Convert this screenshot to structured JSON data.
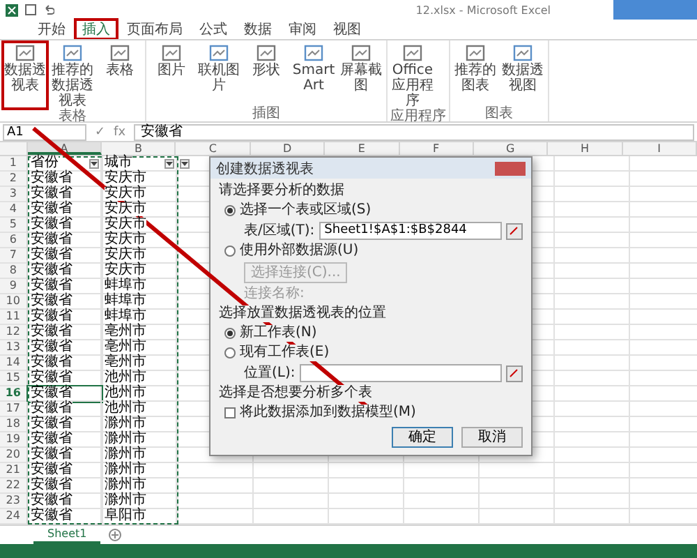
{
  "window": {
    "title": "12.xlsx - Microsoft Excel"
  },
  "tabs": [
    {
      "label": "开始",
      "selected": false,
      "highlighted": false
    },
    {
      "label": "插入",
      "selected": true,
      "highlighted": true
    },
    {
      "label": "页面布局",
      "selected": false,
      "highlighted": false
    },
    {
      "label": "公式",
      "selected": false,
      "highlighted": false
    },
    {
      "label": "数据",
      "selected": false,
      "highlighted": false
    },
    {
      "label": "审阅",
      "selected": false,
      "highlighted": false
    },
    {
      "label": "视图",
      "selected": false,
      "highlighted": false
    }
  ],
  "ribbon": {
    "groups": [
      {
        "label": "表格",
        "buttons": [
          {
            "label": "数据透视表",
            "highlighted": true
          },
          {
            "label": "推荐的数据透视表",
            "highlighted": false
          },
          {
            "label": "表格",
            "highlighted": false
          }
        ]
      },
      {
        "label": "插图",
        "buttons": [
          {
            "label": "图片",
            "highlighted": false
          },
          {
            "label": "联机图片",
            "highlighted": false
          },
          {
            "label": "形状",
            "highlighted": false
          },
          {
            "label": "SmartArt",
            "highlighted": false
          },
          {
            "label": "屏幕截图",
            "highlighted": false
          }
        ]
      },
      {
        "label": "应用程序",
        "buttons": [
          {
            "label": "Office应用程序",
            "highlighted": false
          }
        ]
      },
      {
        "label": "图表",
        "buttons": [
          {
            "label": "推荐的图表",
            "highlighted": false
          },
          {
            "label": "数据透视图",
            "highlighted": false
          }
        ]
      }
    ]
  },
  "formula_bar": {
    "name_box": "A1",
    "confirm": "✓",
    "function": "fx",
    "value": "安徽省"
  },
  "sheet": {
    "columns": [
      "A",
      "B",
      "C",
      "D",
      "E",
      "F",
      "G",
      "H",
      "I"
    ],
    "rows": [
      {
        "number": "1",
        "cells": [
          "省份",
          "城市"
        ],
        "selected": false
      },
      {
        "number": "2",
        "cells": [
          "安徽省",
          "安庆市"
        ],
        "selected": false
      },
      {
        "number": "3",
        "cells": [
          "安徽省",
          "安庆市"
        ],
        "selected": false
      },
      {
        "number": "4",
        "cells": [
          "安徽省",
          "安庆市"
        ],
        "selected": false
      },
      {
        "number": "5",
        "cells": [
          "安徽省",
          "安庆市"
        ],
        "selected": false
      },
      {
        "number": "6",
        "cells": [
          "安徽省",
          "安庆市"
        ],
        "selected": false
      },
      {
        "number": "7",
        "cells": [
          "安徽省",
          "安庆市"
        ],
        "selected": false
      },
      {
        "number": "8",
        "cells": [
          "安徽省",
          "安庆市"
        ],
        "selected": false
      },
      {
        "number": "9",
        "cells": [
          "安徽省",
          "蚌埠市"
        ],
        "selected": false
      },
      {
        "number": "10",
        "cells": [
          "安徽省",
          "蚌埠市"
        ],
        "selected": false
      },
      {
        "number": "11",
        "cells": [
          "安徽省",
          "蚌埠市"
        ],
        "selected": false
      },
      {
        "number": "12",
        "cells": [
          "安徽省",
          "亳州市"
        ],
        "selected": false
      },
      {
        "number": "13",
        "cells": [
          "安徽省",
          "亳州市"
        ],
        "selected": false
      },
      {
        "number": "14",
        "cells": [
          "安徽省",
          "亳州市"
        ],
        "selected": false
      },
      {
        "number": "15",
        "cells": [
          "安徽省",
          "池州市"
        ],
        "selected": false
      },
      {
        "number": "16",
        "cells": [
          "安徽省",
          "池州市"
        ],
        "selected": true
      },
      {
        "number": "17",
        "cells": [
          "安徽省",
          "池州市"
        ],
        "selected": false
      },
      {
        "number": "18",
        "cells": [
          "安徽省",
          "滁州市"
        ],
        "selected": false
      },
      {
        "number": "19",
        "cells": [
          "安徽省",
          "滁州市"
        ],
        "selected": false
      },
      {
        "number": "20",
        "cells": [
          "安徽省",
          "滁州市"
        ],
        "selected": false
      },
      {
        "number": "21",
        "cells": [
          "安徽省",
          "滁州市"
        ],
        "selected": false
      },
      {
        "number": "22",
        "cells": [
          "安徽省",
          "滁州市"
        ],
        "selected": false
      },
      {
        "number": "23",
        "cells": [
          "安徽省",
          "滁州市"
        ],
        "selected": false
      },
      {
        "number": "24",
        "cells": [
          "安徽省",
          "阜阳市"
        ],
        "selected": false
      }
    ],
    "sheet_tabs": [
      {
        "label": "Sheet1",
        "selected": true
      }
    ]
  },
  "dialog": {
    "title": "创建数据透视表",
    "section_1": "请选择要分析的数据",
    "options_1": [
      {
        "label": "选择一个表或区域(S)",
        "selected": true
      },
      {
        "label": "使用外部数据源(U)",
        "selected": false
      }
    ],
    "range_label": "表/区域(T):",
    "range_value": "Sheet1!$A$1:$B$2844",
    "connection_button": "选择连接(C)...",
    "connection_name": "连接名称:",
    "section_2": "选择放置数据透视表的位置",
    "options_2": [
      {
        "label": "新工作表(N)",
        "selected": true
      },
      {
        "label": "现有工作表(E)",
        "selected": false
      }
    ],
    "location_label": "位置(L):",
    "section_3": "选择是否想要分析多个表",
    "data_model": {
      "label": "将此数据添加到数据模型(M)",
      "checked": false
    },
    "buttons": [
      "确定",
      "取消"
    ]
  }
}
